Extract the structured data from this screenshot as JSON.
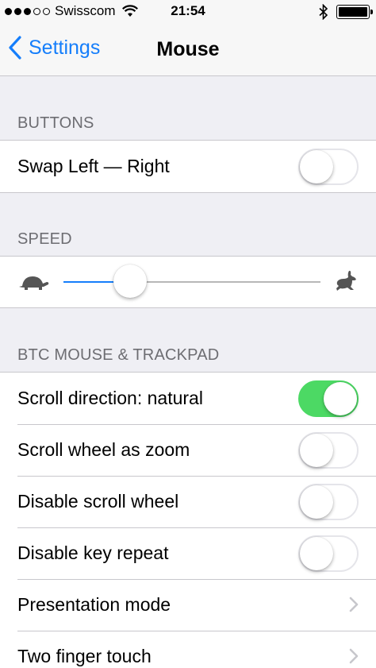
{
  "status_bar": {
    "carrier": "Swisscom",
    "time": "21:54",
    "signal_bars_filled": 3,
    "signal_bars_total": 5
  },
  "nav": {
    "back_label": "Settings",
    "title": "Mouse"
  },
  "sections": {
    "buttons": {
      "header": "BUTTONS",
      "swap": {
        "label": "Swap Left — Right",
        "on": false
      }
    },
    "speed": {
      "header": "SPEED",
      "value": 0.26,
      "min_icon": "turtle-icon",
      "max_icon": "hare-icon"
    },
    "btc": {
      "header": "BTC MOUSE & TRACKPAD",
      "items": [
        {
          "label": "Scroll direction: natural",
          "type": "toggle",
          "on": true
        },
        {
          "label": "Scroll wheel as zoom",
          "type": "toggle",
          "on": false
        },
        {
          "label": "Disable scroll wheel",
          "type": "toggle",
          "on": false
        },
        {
          "label": "Disable key repeat",
          "type": "toggle",
          "on": false
        },
        {
          "label": "Presentation mode",
          "type": "disclosure"
        },
        {
          "label": "Two finger touch",
          "type": "disclosure"
        }
      ]
    }
  },
  "colors": {
    "accent": "#157efb",
    "toggle_on": "#4cd964",
    "background": "#efeff4",
    "header_text": "#6d6d72"
  }
}
